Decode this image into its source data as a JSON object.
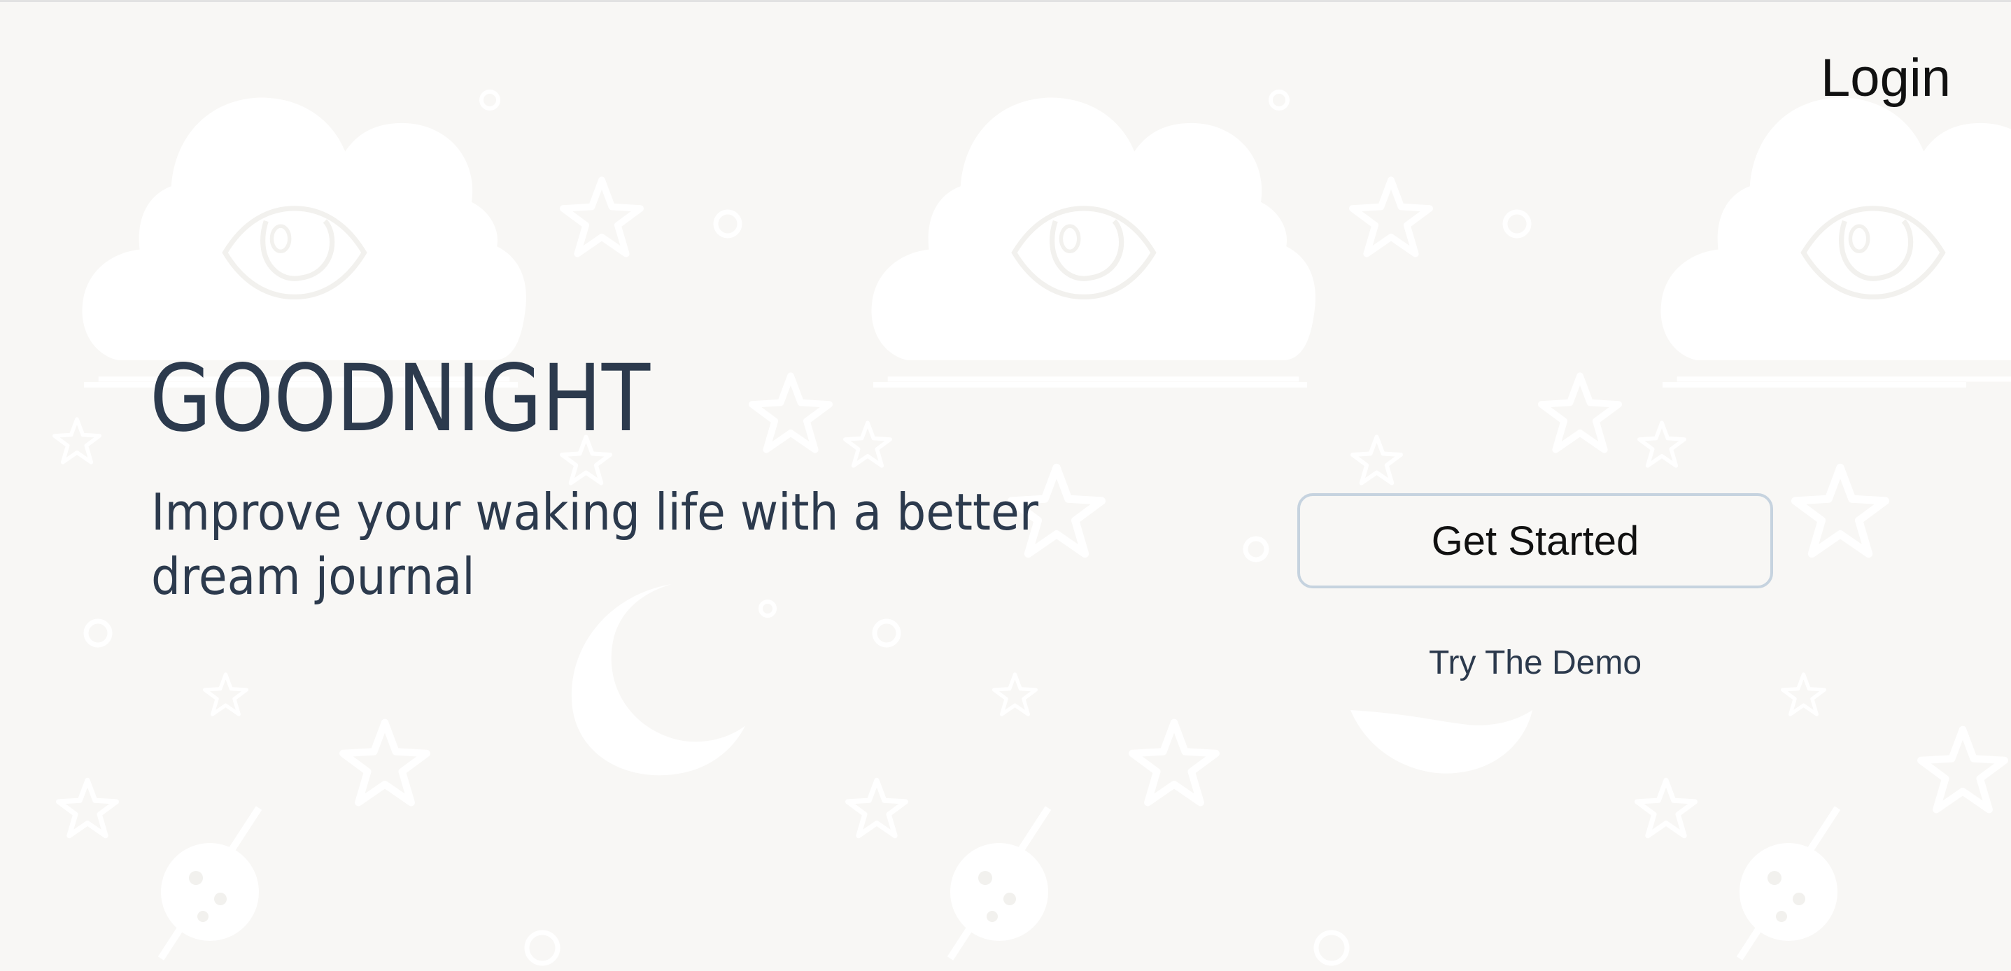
{
  "header": {
    "login_label": "Login"
  },
  "hero": {
    "title": "GOODNIGHT",
    "tagline": "Improve your waking life with a better dream journal"
  },
  "actions": {
    "get_started_label": "Get Started",
    "try_demo_label": "Try The Demo"
  },
  "background": {
    "pattern_icons": [
      "cloud-eye-icon",
      "star-icon",
      "moon-icon",
      "planet-icon",
      "circle-dot-icon"
    ]
  },
  "colors": {
    "background": "#f8f7f5",
    "pattern": "#ffffff",
    "text_primary": "#2c3a4d",
    "button_border": "#c6d3df"
  }
}
